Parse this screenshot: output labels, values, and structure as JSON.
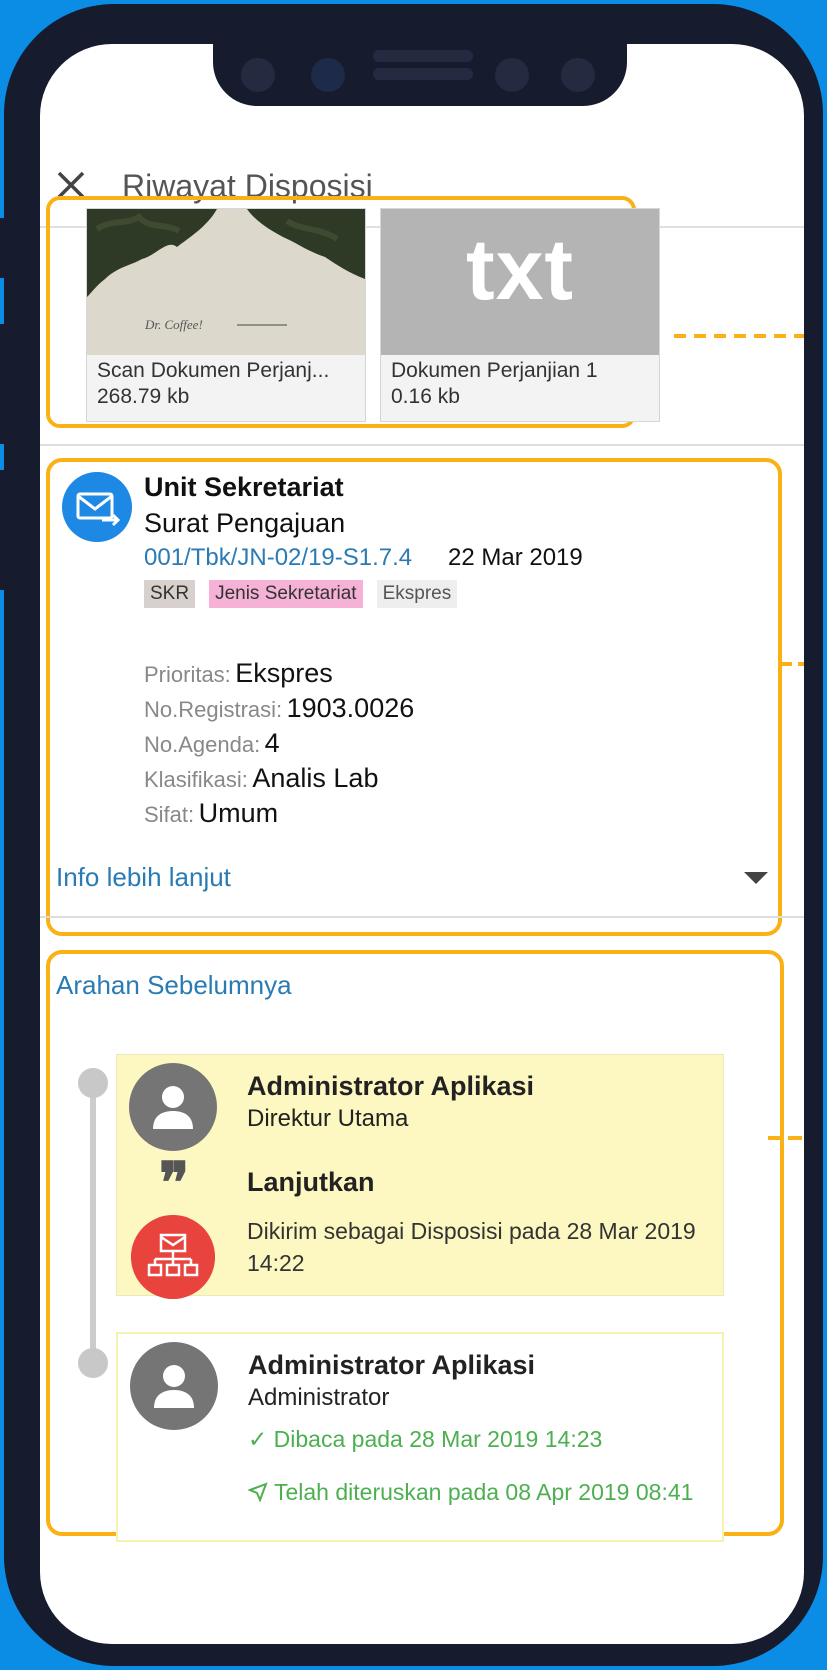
{
  "header": {
    "title": "Riwayat Disposisi"
  },
  "attachments": [
    {
      "name": "Scan Dokumen Perjanj...",
      "size": "268.79 kb",
      "thumb_text": "Dr. Coffee!"
    },
    {
      "name": "Dokumen Perjanjian 1",
      "size": "0.16 kb",
      "thumb_text": "txt"
    }
  ],
  "letter": {
    "unit": "Unit Sekretariat",
    "type": "Surat Pengajuan",
    "number": "001/Tbk/JN-02/19-S1.7.4",
    "date": "22 Mar 2019",
    "tags": [
      "SKR",
      "Jenis Sekretariat",
      "Ekspres"
    ],
    "details": [
      {
        "label": "Prioritas:",
        "value": "Ekspres"
      },
      {
        "label": "No.Registrasi:",
        "value": "1903.0026"
      },
      {
        "label": "No.Agenda:",
        "value": "4"
      },
      {
        "label": "Klasifikasi:",
        "value": "Analis Lab"
      },
      {
        "label": "Sifat:",
        "value": "Umum"
      }
    ],
    "more_info": "Info lebih lanjut"
  },
  "history": {
    "title": "Arahan Sebelumnya",
    "entries": [
      {
        "name": "Administrator Aplikasi",
        "role": "Direktur Utama",
        "action": "Lanjutkan",
        "status": "Dikirim sebagai Disposisi pada 28 Mar 2019 14:22"
      },
      {
        "name": "Administrator Aplikasi",
        "role": "Administrator",
        "read": "✓ Dibaca pada 28 Mar 2019 14:23",
        "forwarded": "Telah diteruskan pada 08 Apr 2019 08:41"
      }
    ]
  },
  "colors": {
    "highlight": "#f9b115",
    "link": "#2a7bb4",
    "success": "#4caf50",
    "disposition": "#e8433c",
    "background": "#0b8de6",
    "frame": "#161c2e"
  }
}
